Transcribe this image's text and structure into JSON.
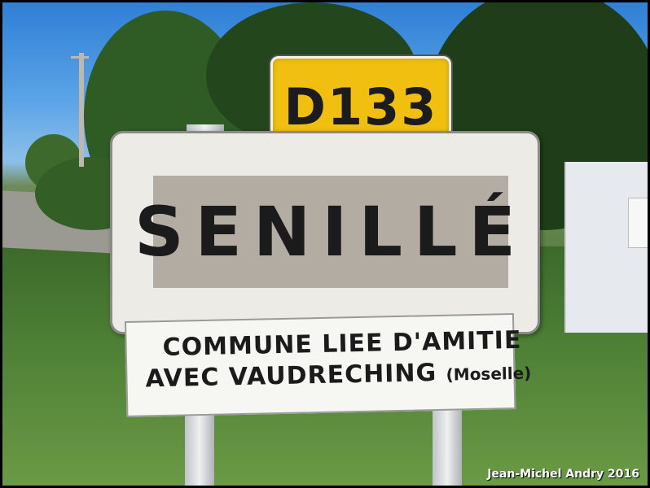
{
  "route_sign": {
    "text": "D133",
    "background": "#f0bf10"
  },
  "town_sign": {
    "name": "SENILLÉ"
  },
  "twin_sign": {
    "line1": "COMMUNE LIEE D'AMITIE",
    "line2": "AVEC VAUDRECHING",
    "region": "(Moselle)"
  },
  "credit": "Jean-Michel Andry 2016",
  "colors": {
    "sky": "#2f7fd6",
    "grass": "#4d7f35",
    "sign_panel": "#b2aca3"
  }
}
